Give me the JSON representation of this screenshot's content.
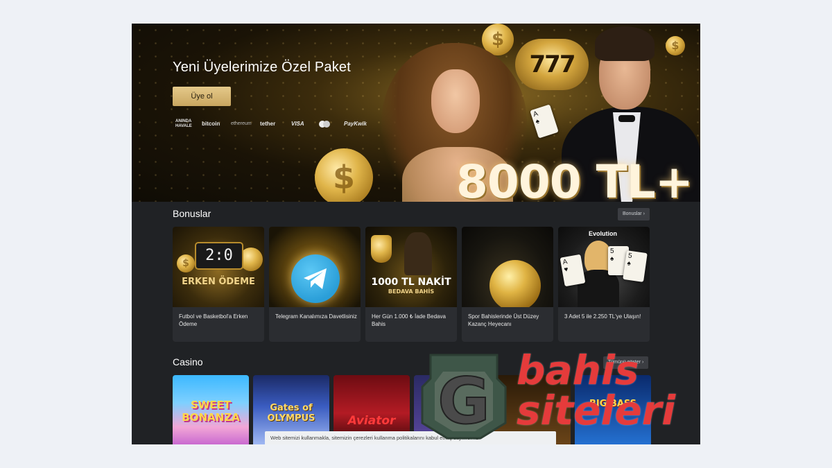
{
  "hero": {
    "title": "Yeni Üyelerimize Özel Paket",
    "signup_label": "Üye ol",
    "promo_amount": "8000 TL+",
    "slot_reels": "777",
    "payment_methods": [
      "ANINDA HAVALE",
      "bitcoin",
      "ethereum",
      "tether",
      "VISA",
      "mastercard-logo",
      "PayKwik"
    ]
  },
  "bonuses": {
    "title": "Bonuslar",
    "link_label": "Bonuslar ›",
    "cards": [
      {
        "image_text": "ERKEN ÖDEME",
        "score": "2:0",
        "caption": "Futbol ve Basketbol'a Erken Ödeme"
      },
      {
        "caption": "Telegram Kanalımıza Davetlisiniz"
      },
      {
        "image_text": "1000 TL NAKİT",
        "image_subtext": "BEDAVA BAHİS",
        "caption": "Her Gün 1.000 ₺ İade Bedava Bahis"
      },
      {
        "caption": "Spor Bahislerinde Üst Düzey Kazanç Heyecanı"
      },
      {
        "brand": "Evolution",
        "caption": "3 Adet 5 ile 2.250 TL'ye Ulaşın!"
      }
    ]
  },
  "casino": {
    "title": "Casino",
    "link_label": "Tümünü göster ›",
    "games": [
      {
        "name": "SWEET BONANZA"
      },
      {
        "name": "Gates of OLYMPUS"
      },
      {
        "name": "Aviator"
      },
      {
        "name": ""
      },
      {
        "name": ""
      },
      {
        "name": "BIG BASS"
      }
    ]
  },
  "cookie_notice": "Web sitemizi kullanmakla, sitemizin çerezleri kullanma politikalarını kabul etmiş sayılırsınız.",
  "watermark": {
    "letter": "G",
    "line1": "bahis",
    "line2": "siteleri",
    "color": "#e53b3b"
  },
  "colors": {
    "accent_gold": "#c9a660",
    "panel_bg": "#202225",
    "card_bg": "#2b2d31"
  }
}
